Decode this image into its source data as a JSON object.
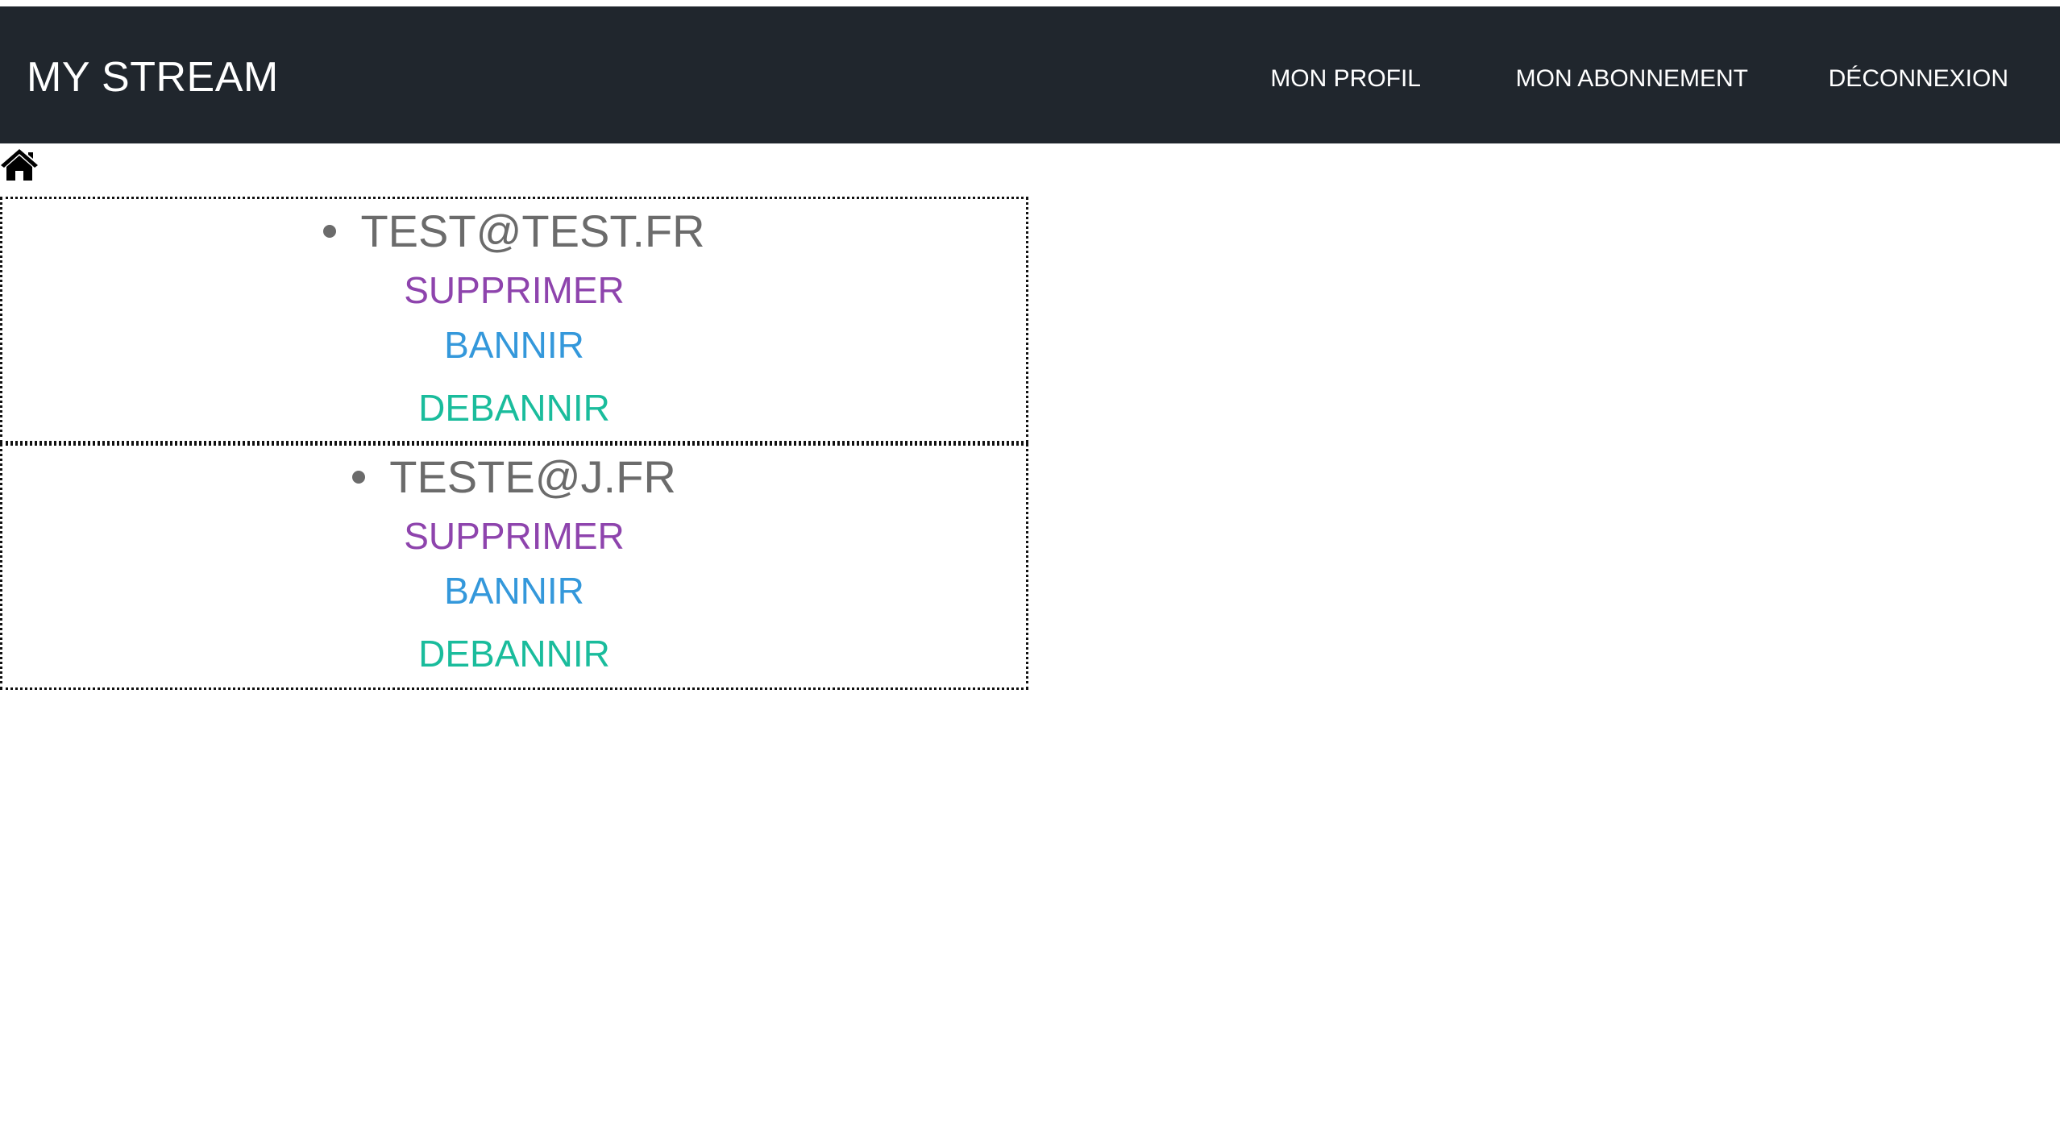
{
  "navbar": {
    "brand": "MY STREAM",
    "links": [
      {
        "label": "MON PROFIL"
      },
      {
        "label": "MON ABONNEMENT"
      },
      {
        "label": "DÉCONNEXION"
      }
    ]
  },
  "home_icon": "home-icon",
  "users": [
    {
      "email": "TEST@TEST.FR",
      "actions": {
        "delete": "SUPPRIMER",
        "ban": "BANNIR",
        "unban": "DEBANNIR"
      }
    },
    {
      "email": "TESTE@J.FR",
      "actions": {
        "delete": "SUPPRIMER",
        "ban": "BANNIR",
        "unban": "DEBANNIR"
      }
    }
  ],
  "colors": {
    "navbar_bg": "#20262d",
    "email_text": "#6b6b6b",
    "delete": "#8e44ad",
    "ban": "#3498db",
    "unban": "#1abc9c"
  }
}
